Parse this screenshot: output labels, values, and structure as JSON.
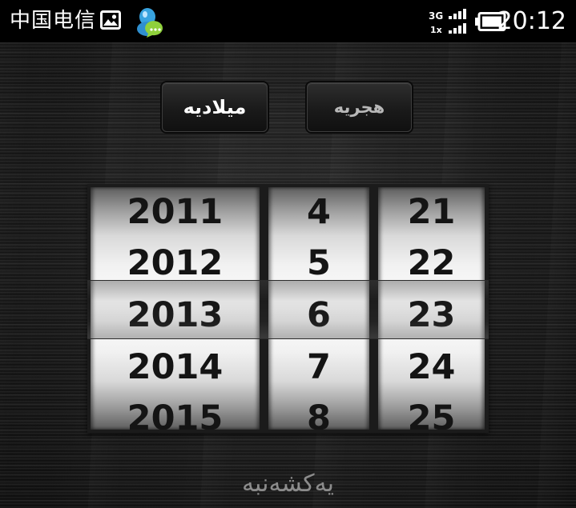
{
  "status_bar": {
    "carrier": "中国电信",
    "clock": "20:12",
    "network_primary": "3G",
    "network_secondary": "1x",
    "icons": [
      "picture-icon",
      "chat-app-icon",
      "signal-icon",
      "battery-icon"
    ]
  },
  "calendar_modes": {
    "gregorian_label": "ميلاديه",
    "hijri_label": "هجريه",
    "selected": "gregorian"
  },
  "picker": {
    "years": [
      "2011",
      "2012",
      "2013",
      "2014",
      "2015"
    ],
    "months": [
      "4",
      "5",
      "6",
      "7",
      "8"
    ],
    "days": [
      "21",
      "22",
      "23",
      "24",
      "25"
    ],
    "selected": {
      "year": "2013",
      "month": "6",
      "day": "23"
    }
  },
  "weekday": "يەكشەنبە",
  "colors": {
    "status_bar_bg": "#000000",
    "background": "#1c1c1c",
    "selected_button_text": "#ffffff",
    "unselected_button_text": "#b8b8b8",
    "wheel_text": "#141414",
    "weekday_text": "#8c8c8c"
  }
}
